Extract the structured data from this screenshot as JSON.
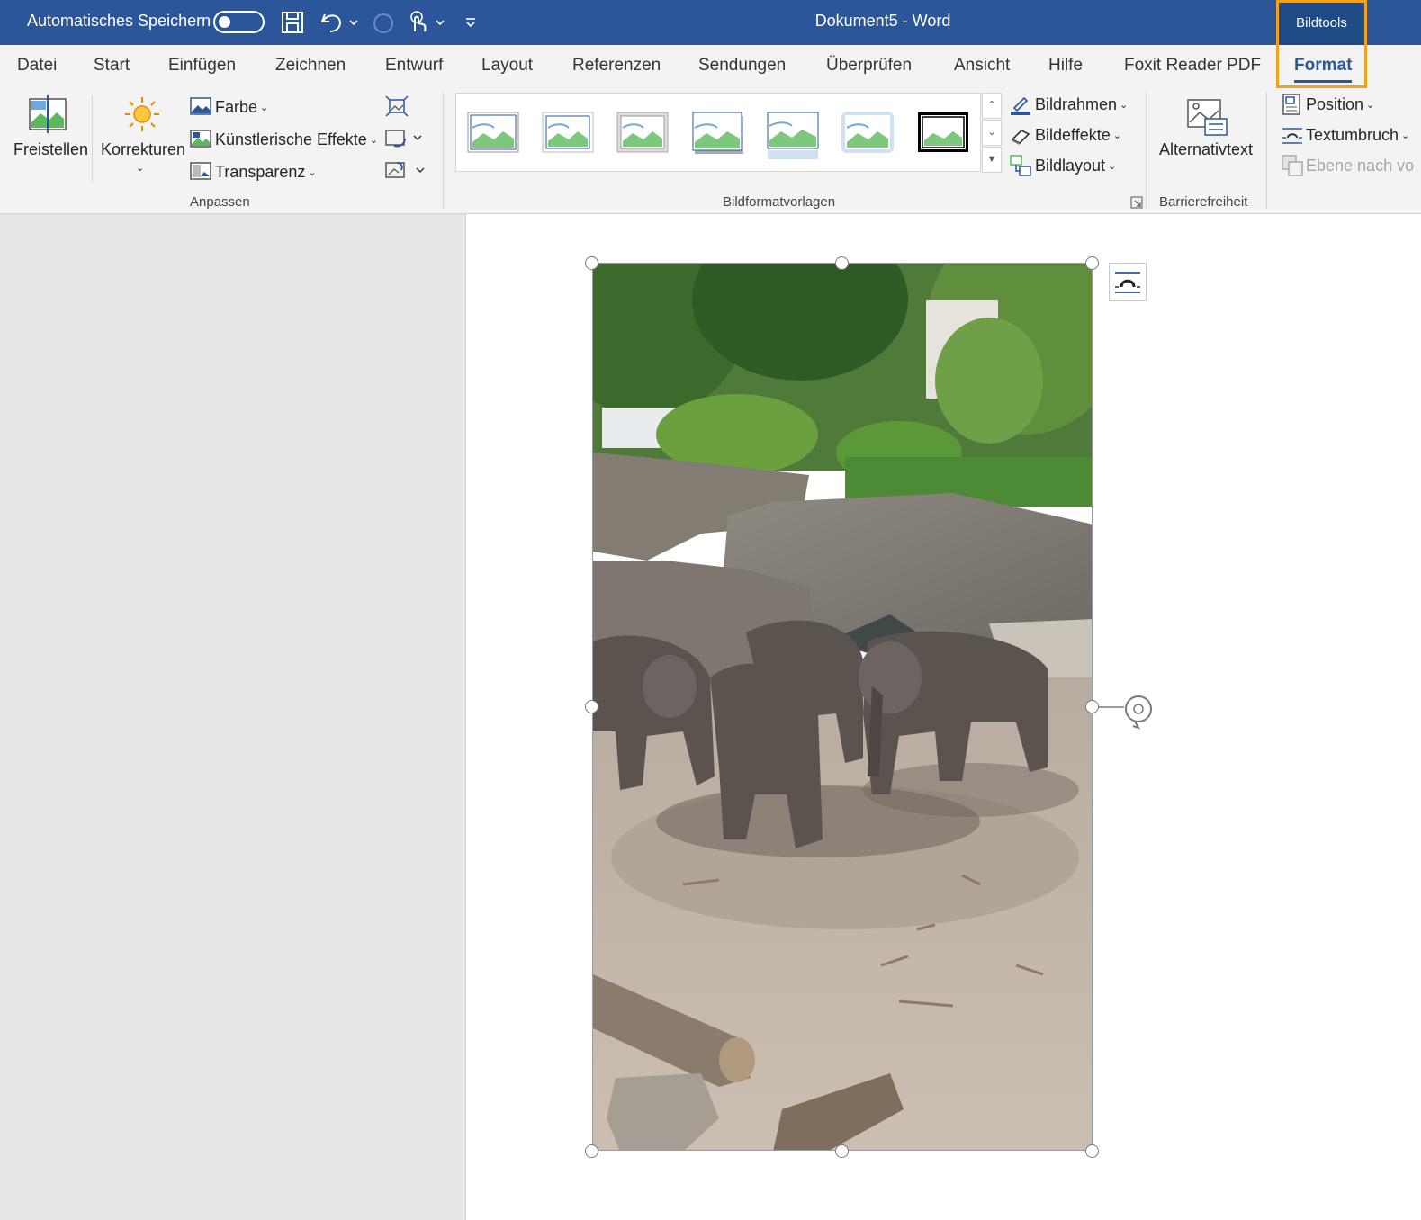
{
  "titlebar": {
    "autosave_label": "Automatisches Speichern",
    "doc_title": "Dokument5  -  Word",
    "contextual_group": "Bildtools"
  },
  "tabs": [
    {
      "label": "Datei"
    },
    {
      "label": "Start"
    },
    {
      "label": "Einfügen"
    },
    {
      "label": "Zeichnen"
    },
    {
      "label": "Entwurf"
    },
    {
      "label": "Layout"
    },
    {
      "label": "Referenzen"
    },
    {
      "label": "Sendungen"
    },
    {
      "label": "Überprüfen"
    },
    {
      "label": "Ansicht"
    },
    {
      "label": "Hilfe"
    },
    {
      "label": "Foxit Reader PDF"
    },
    {
      "label": "Format",
      "active": true
    }
  ],
  "ribbon": {
    "anpassen": {
      "freistellen": "Freistellen",
      "korrekturen": "Korrekturen",
      "farbe": "Farbe",
      "effekte": "Künstlerische Effekte",
      "transparenz": "Transparenz",
      "label": "Anpassen"
    },
    "bildformatvorlagen": {
      "bildrahmen": "Bildrahmen",
      "bildeffekte": "Bildeffekte",
      "bildlayout": "Bildlayout",
      "label": "Bildformatvorlagen"
    },
    "barrierefreiheit": {
      "alternativtext": "Alternativtext",
      "label": "Barrierefreiheit"
    },
    "anordnen": {
      "position": "Position",
      "textumbruch": "Textumbruch",
      "ebene": "Ebene nach vo"
    }
  },
  "colors": {
    "title_bar": "#2b579a",
    "contextual_highlight": "#f0a21e",
    "ribbon_bg": "#f3f3f3"
  }
}
